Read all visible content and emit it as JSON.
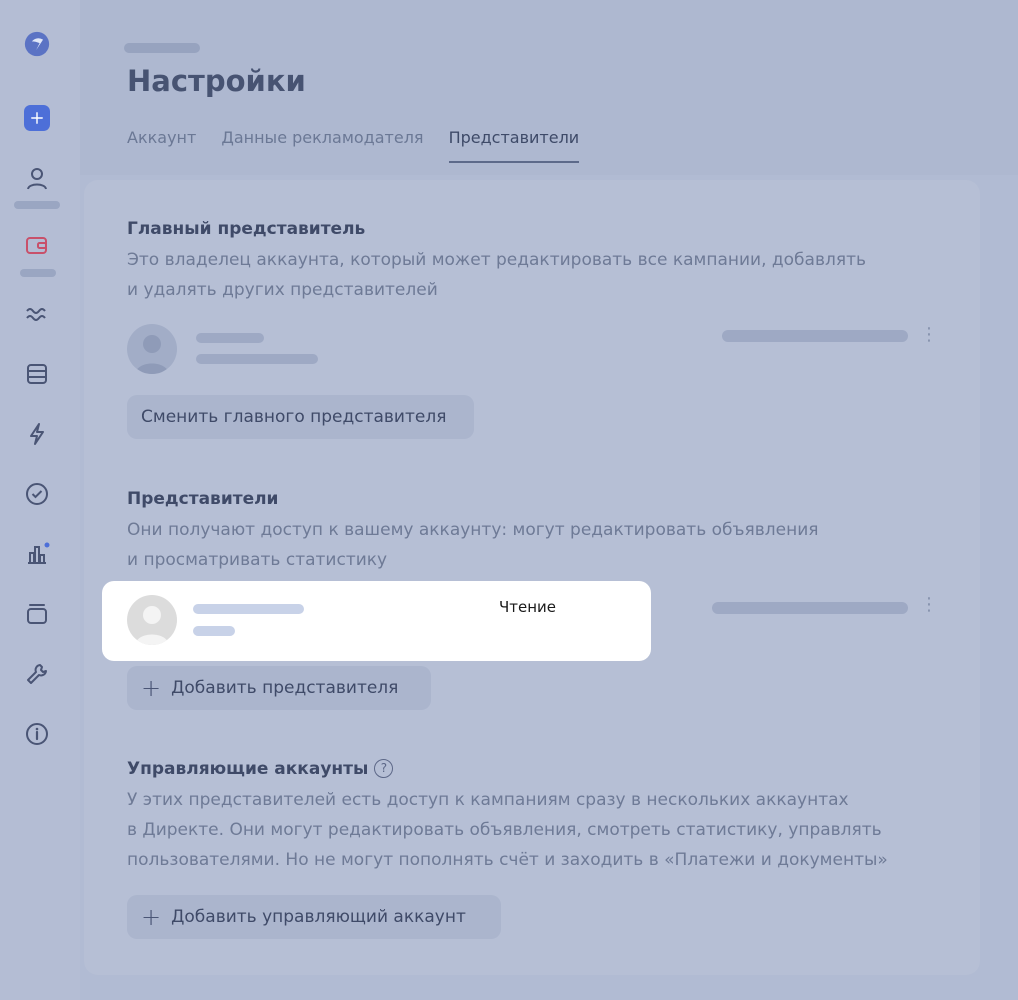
{
  "page": {
    "title": "Настройки",
    "tabs": [
      "Аккаунт",
      "Данные рекламодателя",
      "Представители"
    ]
  },
  "main_rep": {
    "title": "Главный представитель",
    "desc_line1": "Это владелец аккаунта, который может редактировать все кампании, добавлять",
    "desc_line2": "и удалять других представителей",
    "change_button": "Сменить главного представителя"
  },
  "reps": {
    "title": "Представители",
    "desc_line1": "Они получают доступ к вашему аккаунту: могут редактировать объявления",
    "desc_line2": "и просматривать статистику",
    "role": "Чтение",
    "add_button": "Добавить представителя"
  },
  "managing": {
    "title": "Управляющие аккаунты",
    "help": "?",
    "desc_line1": "У этих представителей есть доступ к кампаниям сразу в нескольких аккаунтах",
    "desc_line2": "в Директе. Они могут редактировать объявления, смотреть статистику, управлять",
    "desc_line3": "пользователями. Но не могут пополнять счёт и заходить в «Платежи и документы»",
    "add_button": "Добавить управляющий аккаунт"
  },
  "icons": {
    "logo": "direct-logo-icon",
    "sidebar": [
      "plus-icon",
      "user-icon",
      "wallet-icon",
      "waves-icon",
      "list-icon",
      "lightning-icon",
      "check-circle-icon",
      "chart-icon",
      "folder-icon",
      "wrench-icon",
      "info-icon"
    ]
  },
  "colors": {
    "accent": "#4d6fd8",
    "wallet": "#c8506a"
  }
}
